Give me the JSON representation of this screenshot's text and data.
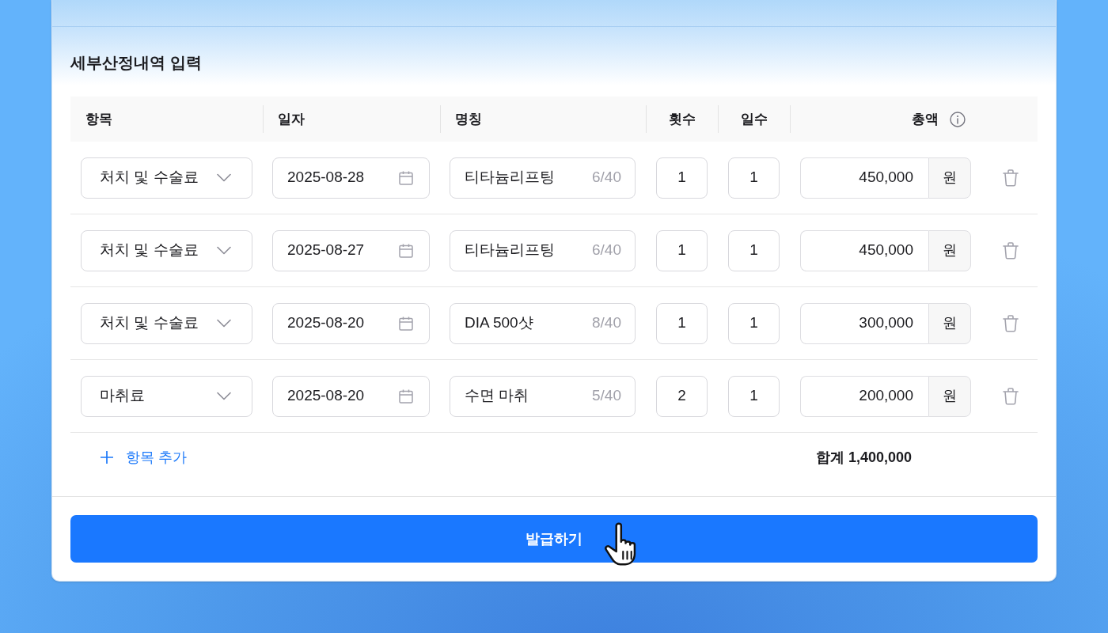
{
  "form": {
    "title": "세부산정내역 입력",
    "table": {
      "columns": [
        {
          "label": "항목",
          "info": false
        },
        {
          "label": "일자",
          "info": false
        },
        {
          "label": "명칭",
          "info": false
        },
        {
          "label": "횟수",
          "info": false
        },
        {
          "label": "일수",
          "info": false
        },
        {
          "label": "총액",
          "info": true
        }
      ],
      "rows": [
        {
          "category": "처치 및 수술료",
          "date": "2025-08-28",
          "name": "티타늄리프팅",
          "name_count": "6/40",
          "times": "1",
          "days": "1",
          "amount": "450,000",
          "unit": "원"
        },
        {
          "category": "처치 및 수술료",
          "date": "2025-08-27",
          "name": "티타늄리프팅",
          "name_count": "6/40",
          "times": "1",
          "days": "1",
          "amount": "450,000",
          "unit": "원"
        },
        {
          "category": "처치 및 수술료",
          "date": "2025-08-20",
          "name": "DIA 500샷",
          "name_count": "8/40",
          "times": "1",
          "days": "1",
          "amount": "300,000",
          "unit": "원"
        },
        {
          "category": "마취료",
          "date": "2025-08-20",
          "name": "수면 마취",
          "name_count": "5/40",
          "times": "2",
          "days": "1",
          "amount": "200,000",
          "unit": "원"
        }
      ]
    },
    "add_item": {
      "label": "항목 추가"
    },
    "total": "합계 1,400,000"
  },
  "submit_button": {
    "label": "발급하기"
  }
}
